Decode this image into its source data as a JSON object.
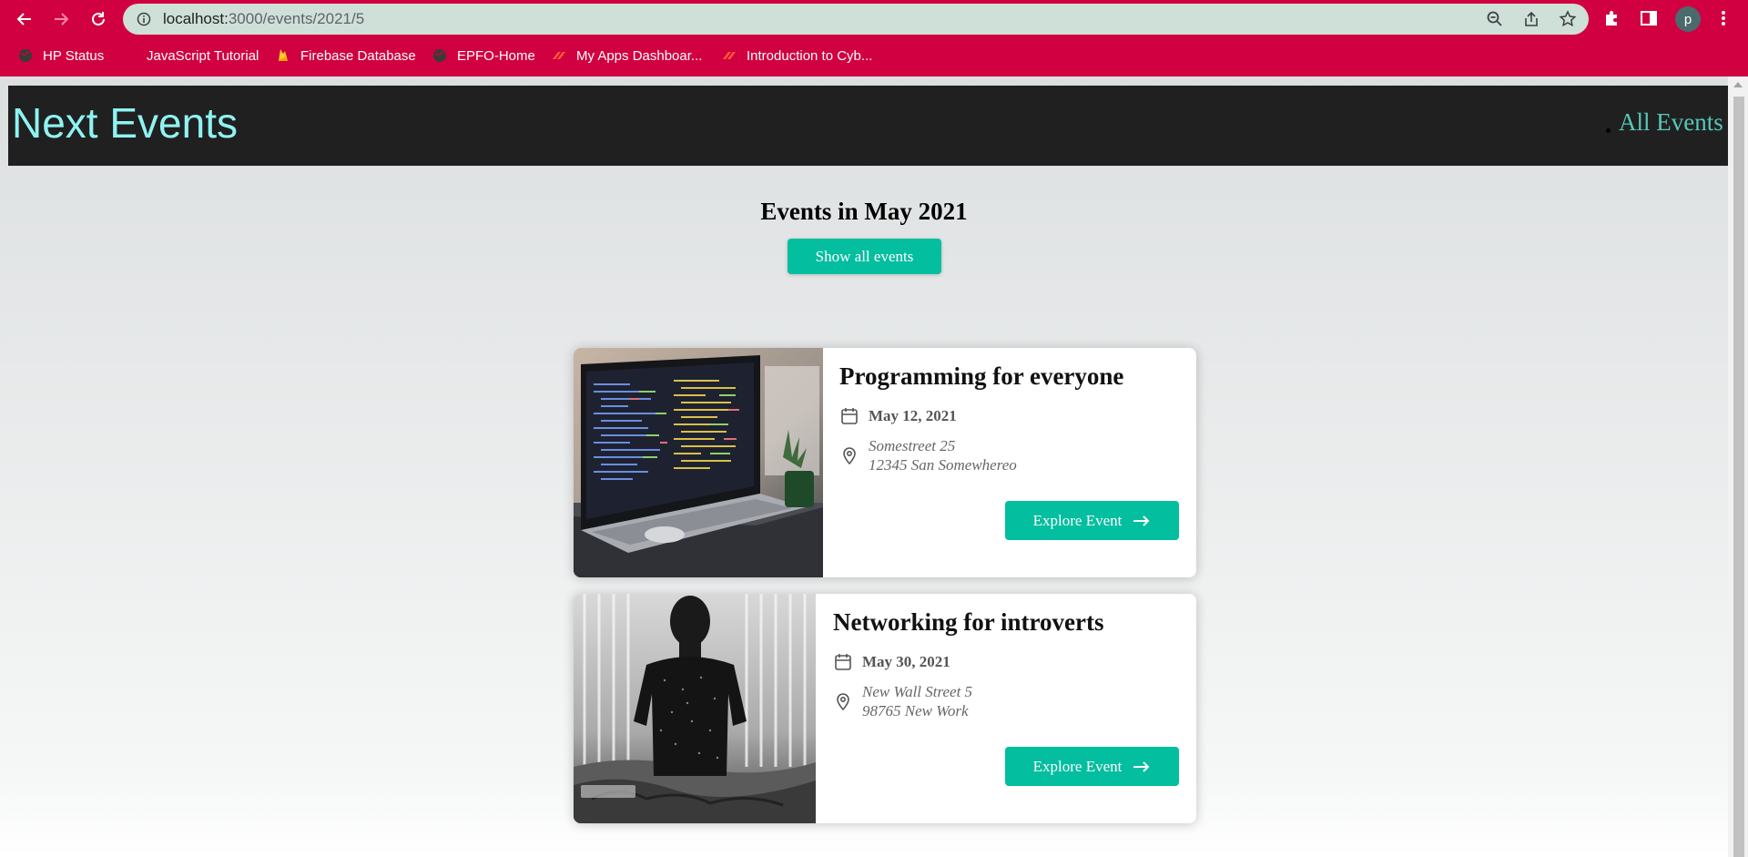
{
  "browser": {
    "url_host": "localhost:",
    "url_path": "3000/events/2021/5",
    "profile_initial": "p",
    "bookmarks": [
      {
        "label": "HP Status"
      },
      {
        "label": "JavaScript Tutorial"
      },
      {
        "label": "Firebase Database"
      },
      {
        "label": "EPFO-Home"
      },
      {
        "label": "My Apps Dashboar..."
      },
      {
        "label": "Introduction to Cyb..."
      }
    ]
  },
  "header": {
    "logo": "Next Events",
    "nav_link": "All Events"
  },
  "page": {
    "title": "Events in May 2021",
    "show_all_label": "Show all events"
  },
  "events": [
    {
      "title": "Programming for everyone",
      "date": "May 12, 2021",
      "address_line1": "Somestreet 25",
      "address_line2": "12345 San Somewhereo",
      "button_label": "Explore Event",
      "image": "laptop-coding-photo"
    },
    {
      "title": "Networking for introverts",
      "date": "May 30, 2021",
      "address_line1": "New Wall Street 5",
      "address_line2": "98765 New Work",
      "button_label": "Explore Event",
      "image": "person-silhouette-photo"
    }
  ],
  "colors": {
    "chrome": "#d10041",
    "accent": "#03be9f",
    "logo": "#8ff3f2",
    "header_bg": "#202020"
  }
}
